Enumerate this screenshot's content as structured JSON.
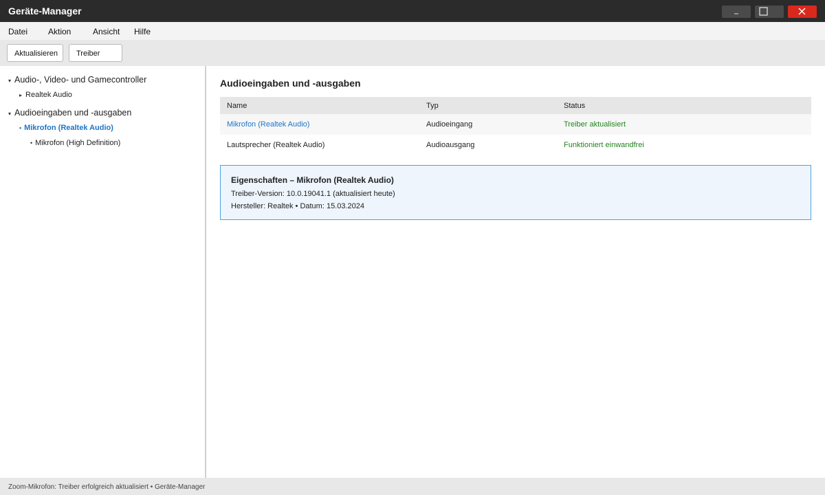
{
  "window": {
    "title": "Geräte-Manager"
  },
  "menubar": {
    "items": [
      {
        "label": "Datei"
      },
      {
        "label": "Aktion"
      },
      {
        "label": "Ansicht"
      },
      {
        "label": "Hilfe"
      }
    ]
  },
  "toolbar": {
    "refresh_label": "Aktualisieren",
    "driver_label": "Treiber"
  },
  "tree": {
    "groups": [
      {
        "label": "Audio-, Video- und Gamecontroller",
        "children": [
          {
            "label": "Realtek Audio"
          }
        ]
      },
      {
        "label": "Audioeingaben und -ausgaben",
        "children": [
          {
            "label": "Mikrofon (Realtek Audio)",
            "selected": true
          },
          {
            "label": "Mikrofon (High Definition)"
          }
        ]
      }
    ]
  },
  "content": {
    "title": "Audioeingaben und -ausgaben",
    "table": {
      "columns": [
        "Name",
        "Typ",
        "Status"
      ],
      "rows": [
        {
          "name": "Mikrofon (Realtek Audio)",
          "type": "Audioeingang",
          "status": "Treiber aktualisiert"
        },
        {
          "name": "Lautsprecher (Realtek Audio)",
          "type": "Audioausgang",
          "status": "Funktioniert einwandfrei"
        }
      ]
    },
    "properties": {
      "title": "Eigenschaften – Mikrofon (Realtek Audio)",
      "line1": "Treiber-Version: 10.0.19041.1 (aktualisiert heute)",
      "line2": "Hersteller: Realtek • Datum: 15.03.2024"
    }
  },
  "statusbar": {
    "text": "Zoom-Mikrofon: Treiber erfolgreich aktualisiert • Geräte-Manager"
  },
  "colors": {
    "titlebar": "#2b2b2b",
    "close_button": "#d9291d",
    "accent": "#1f74c5",
    "status_ok": "#22851d",
    "properties_border": "#4aa3df"
  },
  "icons": {
    "minimize": "minimize-icon",
    "maximize": "maximize-icon",
    "close": "close-icon",
    "expand": "chevron-down-icon",
    "collapsed": "chevron-right-icon"
  }
}
